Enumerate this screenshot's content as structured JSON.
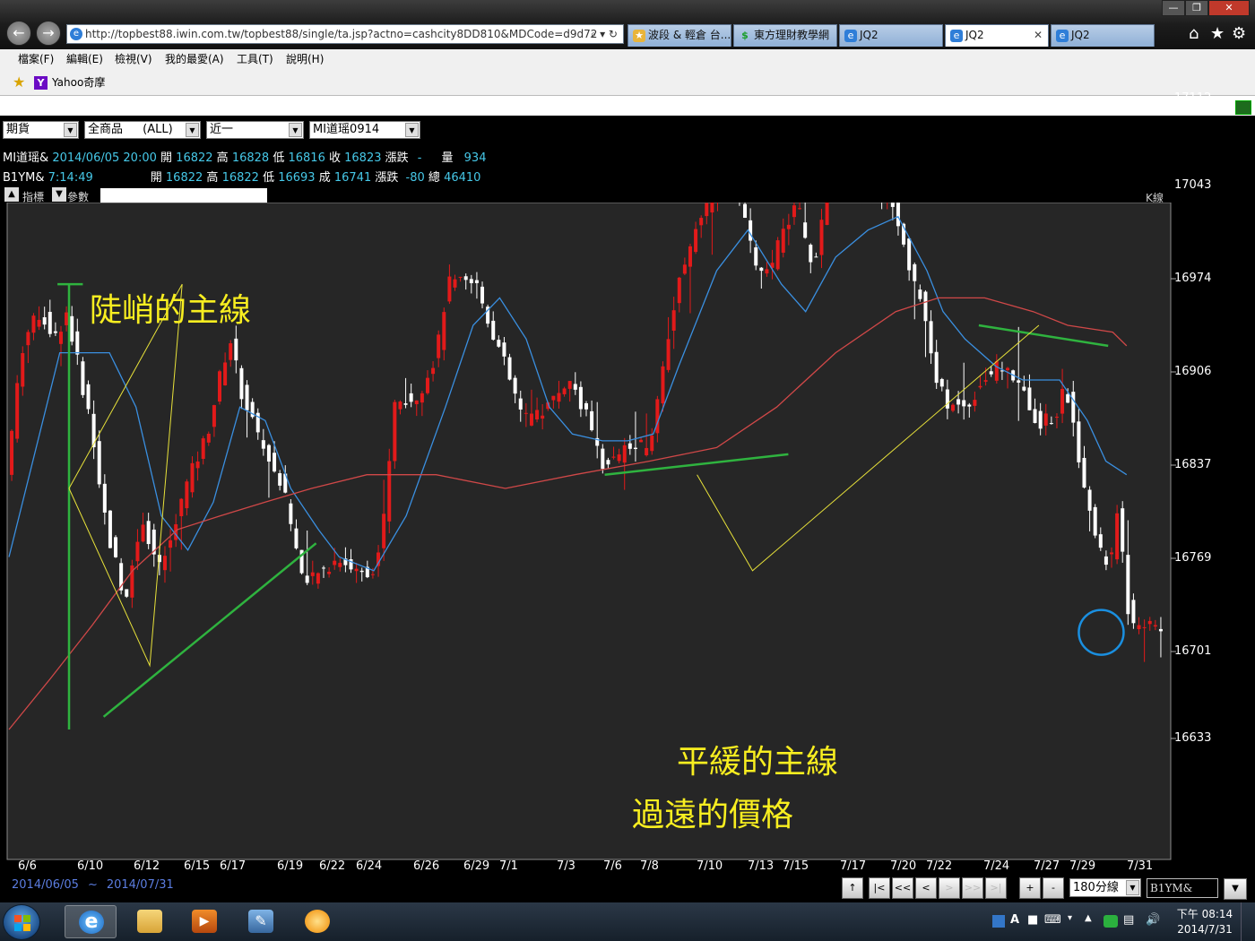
{
  "browser": {
    "url": "http://topbest88.iwin.com.tw/topbest88/single/ta.jsp?actno=cashcity8DD810&MDCode=d9d72",
    "address_controls": "⌕ ▾ ↻",
    "tabs": [
      {
        "label": "波段 & 輕倉 台...",
        "icon": "folder-star-icon",
        "active": false
      },
      {
        "label": "東方理財教學網",
        "icon": "dollar-icon",
        "active": false
      },
      {
        "label": "JQ2",
        "icon": "ie-icon",
        "active": false
      },
      {
        "label": "JQ2",
        "icon": "ie-icon",
        "active": true
      },
      {
        "label": "JQ2",
        "icon": "ie-icon",
        "active": false
      }
    ],
    "menu": [
      "檔案(F)",
      "編輯(E)",
      "檢視(V)",
      "我的最愛(A)",
      "工具(T)",
      "說明(H)"
    ],
    "favorites": [
      {
        "label": "Yahoo奇摩",
        "icon": "yahoo-icon"
      }
    ]
  },
  "toolbar": {
    "market": "期貨",
    "product": "全商品",
    "product_filter": "(ALL)",
    "period": "近一",
    "symbol": "MI道瑶0914"
  },
  "quotes": [
    {
      "name": "MI道瑶&",
      "time": "2014/06/05 20:00",
      "open_label": "開",
      "open": "16822",
      "high_label": "高",
      "high": "16828",
      "low_label": "低",
      "low": "16816",
      "last_label": "收",
      "last": "16823",
      "chg_label": "漲跌",
      "chg": "-",
      "vol_label": "量",
      "vol": "934"
    },
    {
      "name": "B1YM&",
      "time": "7:14:49",
      "open_label": "開",
      "open": "16822",
      "high_label": "高",
      "high": "16822",
      "low_label": "低",
      "low": "16693",
      "last_label": "成",
      "last": "16741",
      "chg_label": "漲跌",
      "chg": "-80",
      "vol_label": "總",
      "vol": "46410"
    }
  ],
  "indicator_bar": {
    "indicator_label": "指標",
    "param_label": "參數",
    "chart_type_label": "K線"
  },
  "annotations": {
    "steep": "陡峭的主線",
    "gentle": "平緩的主線",
    "far": "過遠的價格"
  },
  "colors": {
    "up": "#e21a1a",
    "down": "#ffffff",
    "ma_short": "#3a8fe0",
    "ma_long": "#d04848",
    "trend_line": "#2fb33f",
    "zigzag": "#e8e23a",
    "marker_circle": "#1a8fe0",
    "annotation_text": "#f8ee20"
  },
  "chart_data": {
    "type": "candlestick",
    "y_axis_ticks": [
      17112,
      17043,
      16974,
      16906,
      16837,
      16769,
      16701,
      16633
    ],
    "ylim": [
      16633,
      17112
    ],
    "x_date_labels": [
      "6/6",
      "6/10",
      "6/12",
      "6/15",
      "6/17",
      "6/19",
      "6/22",
      "6/24",
      "6/26",
      "6/29",
      "7/1",
      "7/3",
      "7/6",
      "7/8",
      "7/10",
      "7/13",
      "7/15",
      "7/17",
      "7/20",
      "7/22",
      "7/24",
      "7/27",
      "7/29",
      "7/31"
    ],
    "bar_interval": "180分線",
    "symbol": "B1YM&",
    "date_range": {
      "from": "2014/06/05",
      "sep": "~",
      "to": "2014/07/31"
    },
    "close_path": [
      [
        0,
        16830
      ],
      [
        1.5,
        16930
      ],
      [
        3,
        16950
      ],
      [
        4.2,
        16930
      ],
      [
        5.2,
        16950
      ],
      [
        6.5,
        16900
      ],
      [
        7.5,
        16860
      ],
      [
        8.7,
        16790
      ],
      [
        10.3,
        16740
      ],
      [
        11.8,
        16800
      ],
      [
        13.2,
        16760
      ],
      [
        14.2,
        16780
      ],
      [
        15.5,
        16820
      ],
      [
        17.4,
        16860
      ],
      [
        18.7,
        16910
      ],
      [
        19.4,
        16930
      ],
      [
        20.4,
        16890
      ],
      [
        21.8,
        16860
      ],
      [
        22.8,
        16840
      ],
      [
        24,
        16820
      ],
      [
        25.5,
        16760
      ],
      [
        26.2,
        16750
      ],
      [
        27.4,
        16760
      ],
      [
        28.9,
        16770
      ],
      [
        30.2,
        16760
      ],
      [
        31.6,
        16760
      ],
      [
        32.5,
        16780
      ],
      [
        33.6,
        16880
      ],
      [
        35.7,
        16890
      ],
      [
        37.3,
        16920
      ],
      [
        38.2,
        16970
      ],
      [
        40.7,
        16970
      ],
      [
        41.5,
        16950
      ],
      [
        42.8,
        16920
      ],
      [
        44.8,
        16870
      ],
      [
        46.8,
        16880
      ],
      [
        48.7,
        16900
      ],
      [
        50,
        16880
      ],
      [
        51.4,
        16840
      ],
      [
        53,
        16840
      ],
      [
        53.6,
        16850
      ],
      [
        55.8,
        16850
      ],
      [
        56.8,
        16910
      ],
      [
        58.2,
        16970
      ],
      [
        59.6,
        17010
      ],
      [
        61.6,
        17040
      ],
      [
        62.9,
        17050
      ],
      [
        64.1,
        17010
      ],
      [
        65.6,
        16970
      ],
      [
        67.4,
        17010
      ],
      [
        68.5,
        17030
      ],
      [
        69.8,
        16980
      ],
      [
        71,
        17030
      ],
      [
        72.3,
        17050
      ],
      [
        73.8,
        17050
      ],
      [
        75.2,
        17040
      ],
      [
        76.8,
        17030
      ],
      [
        78,
        16990
      ],
      [
        79.5,
        16950
      ],
      [
        80.4,
        16900
      ],
      [
        81.7,
        16880
      ],
      [
        83.2,
        16880
      ],
      [
        84.5,
        16900
      ],
      [
        86.1,
        16910
      ],
      [
        87.8,
        16900
      ],
      [
        89.2,
        16870
      ],
      [
        90.9,
        16870
      ],
      [
        91.7,
        16900
      ],
      [
        93.1,
        16830
      ],
      [
        94.5,
        16780
      ],
      [
        95.6,
        16760
      ],
      [
        96.3,
        16810
      ],
      [
        97.3,
        16720
      ],
      [
        98,
        16720
      ]
    ],
    "series": [
      {
        "name": "MA short",
        "values": [
          [
            0,
            16770
          ],
          [
            4.4,
            16920
          ],
          [
            8.7,
            16920
          ],
          [
            11,
            16880
          ],
          [
            13.2,
            16800
          ],
          [
            15.5,
            16775
          ],
          [
            17.7,
            16810
          ],
          [
            20,
            16880
          ],
          [
            22.2,
            16870
          ],
          [
            24.4,
            16820
          ],
          [
            26.8,
            16790
          ],
          [
            28.6,
            16770
          ],
          [
            31.6,
            16760
          ],
          [
            34.4,
            16800
          ],
          [
            37.8,
            16880
          ],
          [
            40.2,
            16940
          ],
          [
            42.5,
            16960
          ],
          [
            44.8,
            16930
          ],
          [
            46.8,
            16880
          ],
          [
            48.8,
            16860
          ],
          [
            51.4,
            16855
          ],
          [
            53.6,
            16855
          ],
          [
            55.8,
            16860
          ],
          [
            58,
            16910
          ],
          [
            61.3,
            16980
          ],
          [
            64,
            17010
          ],
          [
            66.9,
            16970
          ],
          [
            69,
            16950
          ],
          [
            71.6,
            16990
          ],
          [
            74.4,
            17010
          ],
          [
            77,
            17020
          ],
          [
            79.5,
            16980
          ],
          [
            80.9,
            16950
          ],
          [
            82.8,
            16930
          ],
          [
            85.5,
            16910
          ],
          [
            87.8,
            16900
          ],
          [
            91,
            16900
          ],
          [
            93.4,
            16870
          ],
          [
            95,
            16840
          ],
          [
            96.8,
            16830
          ]
        ]
      },
      {
        "name": "MA long",
        "values": [
          [
            0,
            16640
          ],
          [
            3.6,
            16680
          ],
          [
            7.2,
            16720
          ],
          [
            10.7,
            16760
          ],
          [
            14.6,
            16790
          ],
          [
            18.3,
            16800
          ],
          [
            22.2,
            16810
          ],
          [
            26.2,
            16820
          ],
          [
            31,
            16830
          ],
          [
            37,
            16830
          ],
          [
            43,
            16820
          ],
          [
            49,
            16830
          ],
          [
            55.5,
            16840
          ],
          [
            61.3,
            16850
          ],
          [
            66.5,
            16880
          ],
          [
            71.6,
            16920
          ],
          [
            76.8,
            16950
          ],
          [
            80.5,
            16960
          ],
          [
            84.5,
            16960
          ],
          [
            88.7,
            16950
          ],
          [
            91.7,
            16940
          ],
          [
            95.6,
            16935
          ],
          [
            96.8,
            16925
          ]
        ]
      }
    ],
    "overlays": {
      "green_lines": [
        [
          [
            4.2,
            16970
          ],
          [
            6.4,
            16970
          ]
        ],
        [
          [
            5.2,
            16970
          ],
          [
            5.2,
            16640
          ]
        ],
        [
          [
            8.2,
            16650
          ],
          [
            26.6,
            16780
          ]
        ],
        [
          [
            51.6,
            16830
          ],
          [
            67.5,
            16845
          ]
        ],
        [
          [
            84,
            16940
          ],
          [
            95.2,
            16925
          ]
        ]
      ],
      "yellow_lines": [
        [
          [
            5.2,
            16820
          ],
          [
            15,
            16970
          ],
          [
            12.2,
            16690
          ],
          [
            5.2,
            16820
          ]
        ],
        [
          [
            59.6,
            16830
          ],
          [
            64.4,
            16760
          ],
          [
            89.2,
            16940
          ]
        ]
      ],
      "circle": {
        "cx": 94.6,
        "cy": 16715,
        "r": 6
      }
    }
  }
}
